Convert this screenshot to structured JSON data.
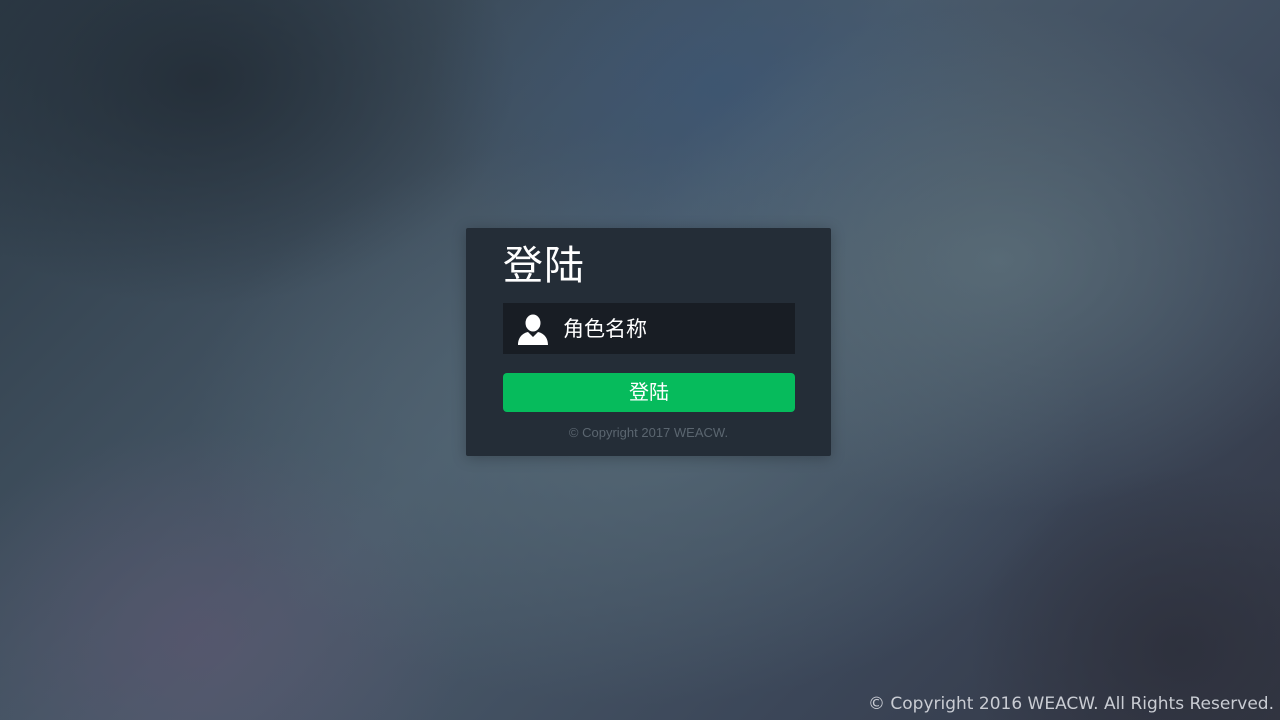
{
  "login": {
    "title": "登陆",
    "role_field": {
      "placeholder": "角色名称",
      "value": "",
      "icon": "user-icon"
    },
    "button_label": "登陆",
    "card_footer": "© Copyright 2017 WEACW.",
    "accent_color": "#06bb5c"
  },
  "footer": {
    "copyright": "© Copyright 2016 WEACW. All Rights Reserved."
  }
}
